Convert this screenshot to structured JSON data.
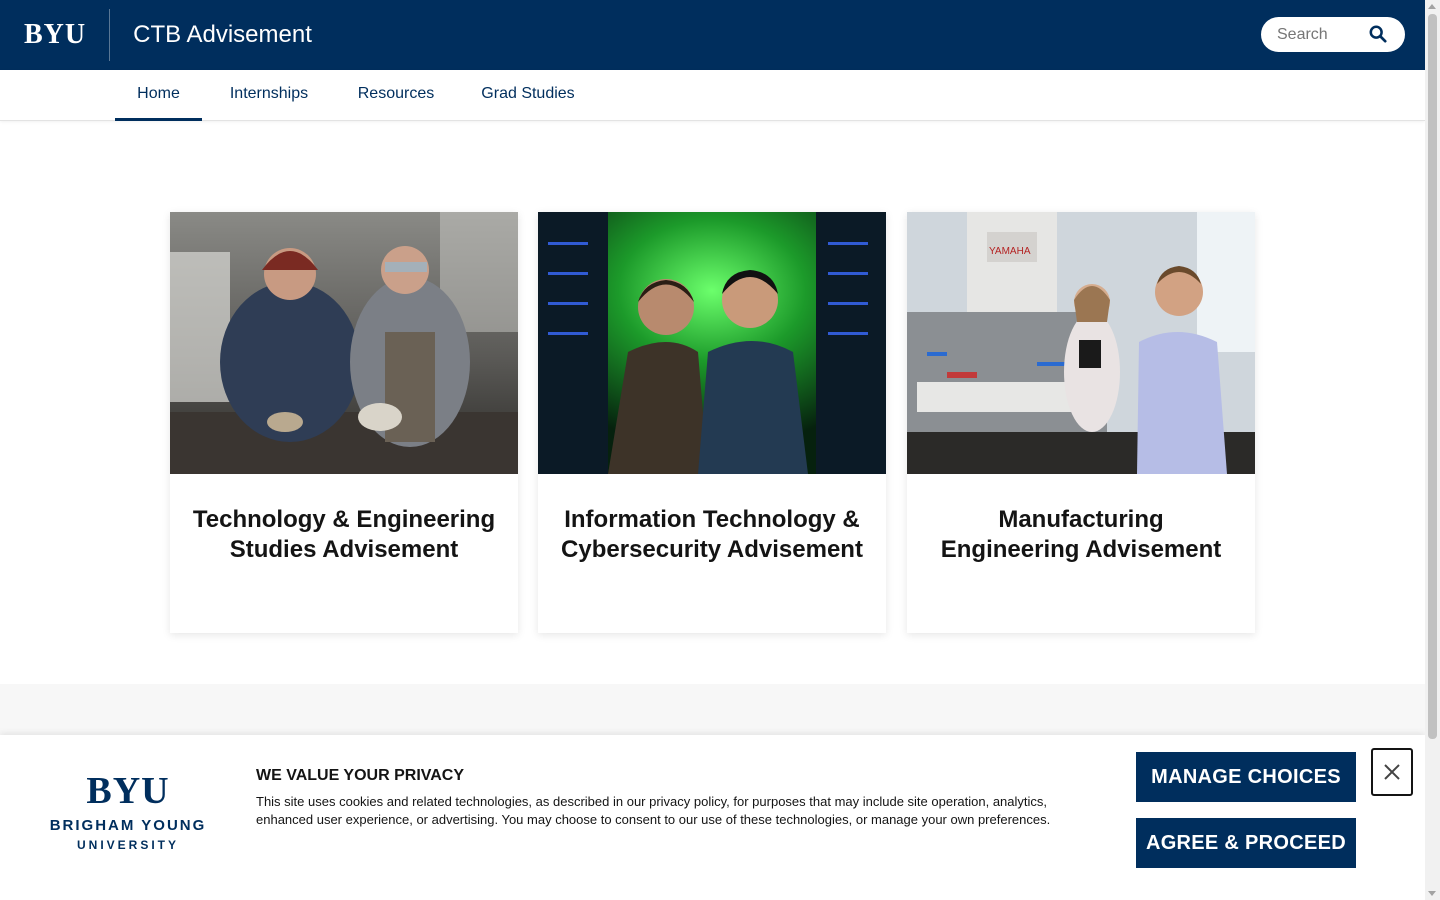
{
  "header": {
    "logo": "BYU",
    "site_title": "CTB Advisement",
    "search_placeholder": "Search"
  },
  "nav": {
    "items": [
      {
        "label": "Home",
        "active": true
      },
      {
        "label": "Internships",
        "active": false
      },
      {
        "label": "Resources",
        "active": false
      },
      {
        "label": "Grad Studies",
        "active": false
      }
    ]
  },
  "cards": [
    {
      "title": "Technology & Engineering Studies Advisement",
      "image": "students-welding-photo"
    },
    {
      "title": "Information Technology & Cybersecurity Advisement",
      "image": "server-room-photo"
    },
    {
      "title": "Manufacturing Engineering Advisement",
      "image": "robotics-lab-photo"
    }
  ],
  "cookie_banner": {
    "logo_main": "BYU",
    "logo_line1": "BRIGHAM YOUNG",
    "logo_line2": "UNIVERSITY",
    "heading": "WE VALUE YOUR PRIVACY",
    "text": "This site uses cookies and related technologies, as described in our privacy policy, for purposes that may include site operation, analytics, enhanced user experience, or advertising. You may choose to consent to our use of these technologies, or manage your own preferences.",
    "manage_label": "MANAGE CHOICES",
    "agree_label": "AGREE & PROCEED",
    "close_icon": "close-icon"
  },
  "colors": {
    "brand_navy": "#002e5d",
    "background": "#ffffff",
    "band_gray": "#f7f7f7"
  }
}
